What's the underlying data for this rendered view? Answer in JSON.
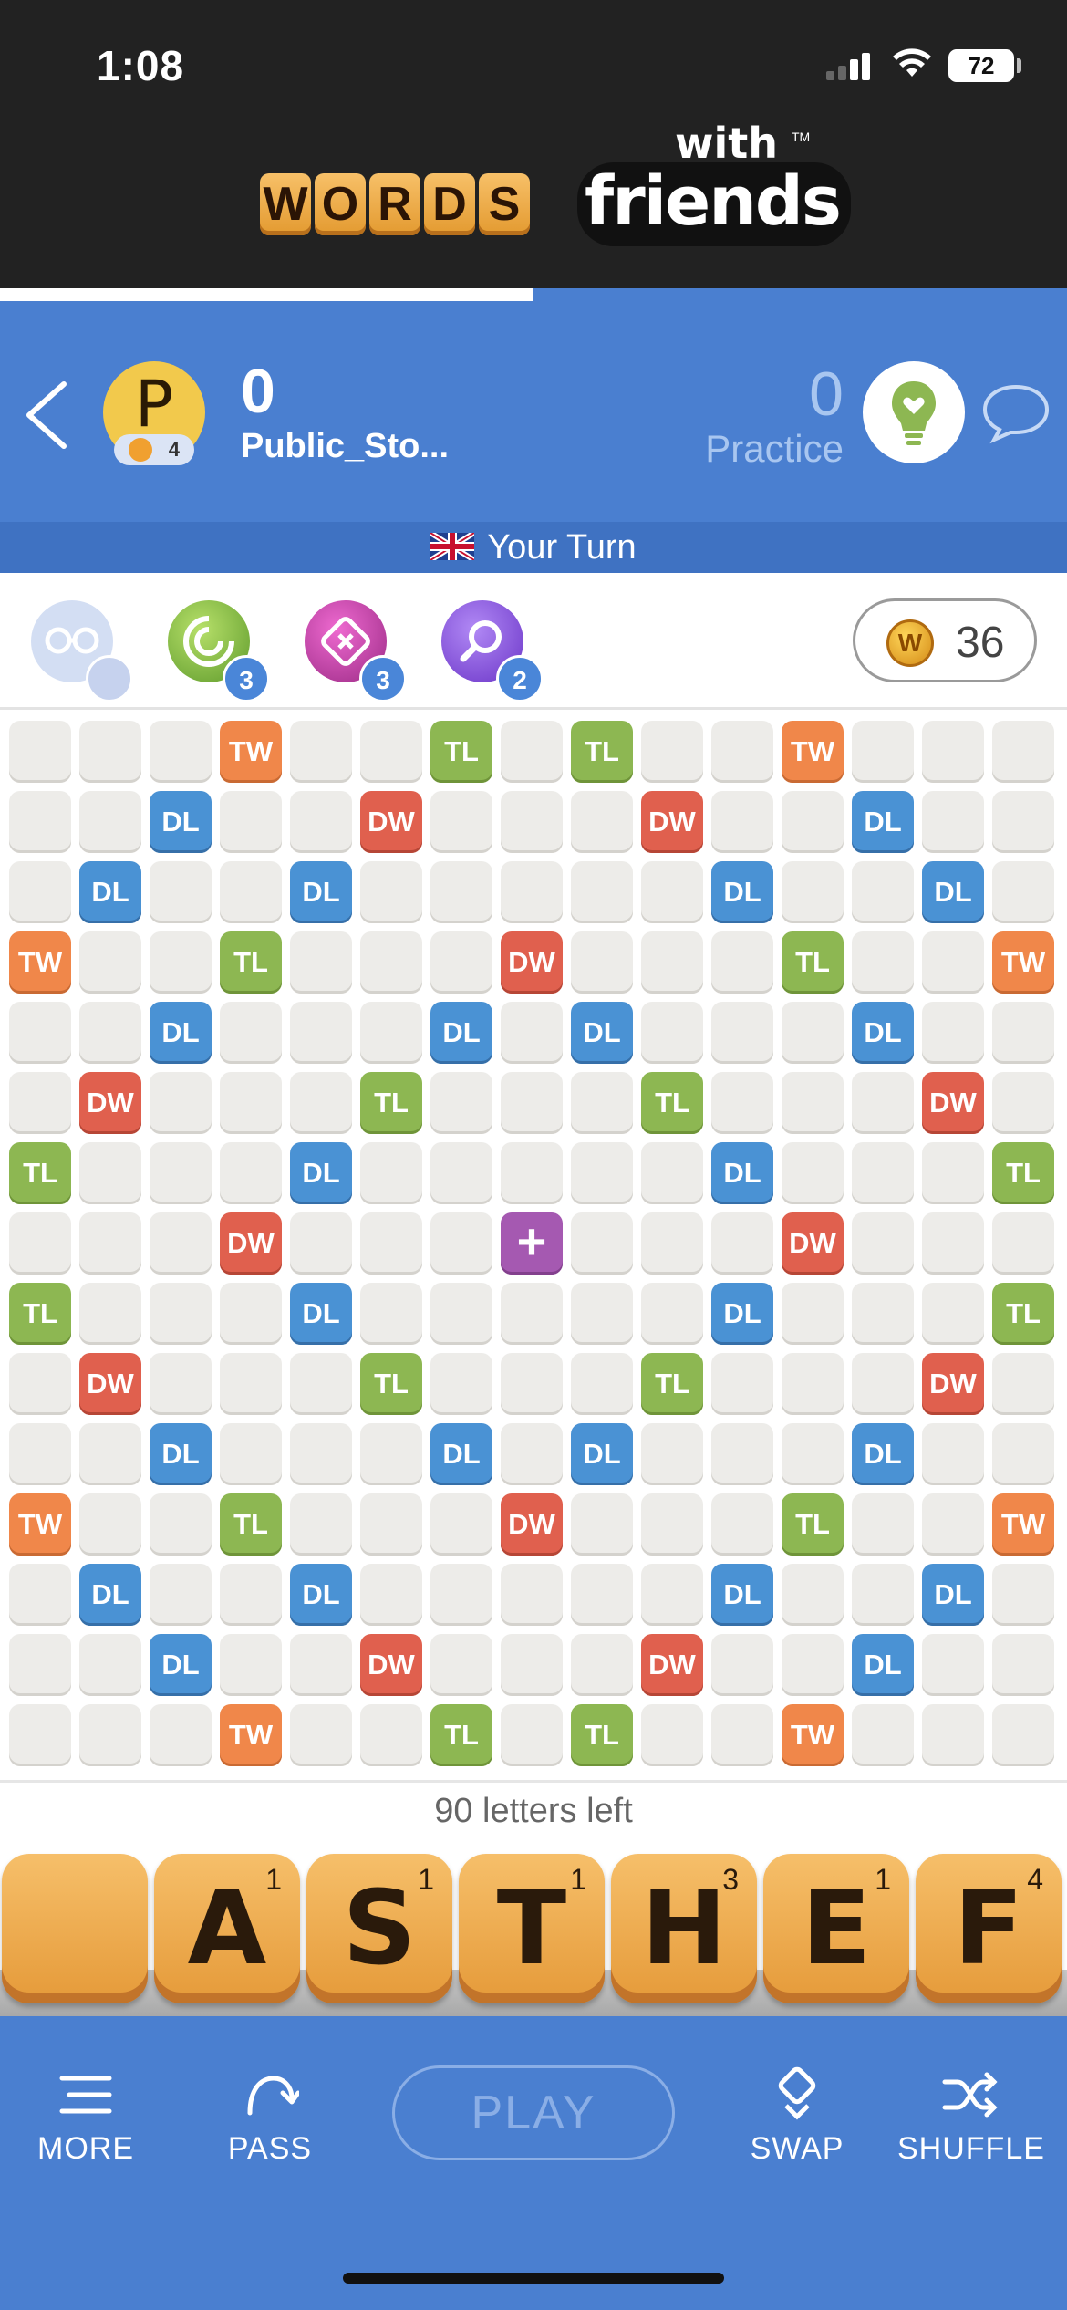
{
  "status": {
    "time": "1:08",
    "battery": "72"
  },
  "logo": {
    "tiles": [
      "W",
      "O",
      "R",
      "D",
      "S"
    ],
    "with": "with",
    "friends": "friends",
    "tm": "TM"
  },
  "game_progress": 0.5,
  "player": {
    "avatar_letter": "P",
    "level": "4",
    "score": "0",
    "name": "Public_Sto..."
  },
  "opponent": {
    "score": "0",
    "label": "Practice"
  },
  "turn": {
    "text": "Your Turn"
  },
  "powerups": [
    {
      "name": "swap-powerup",
      "count": "",
      "color": "#b9c8ea"
    },
    {
      "name": "hindsight-powerup",
      "count": "3",
      "color": "#7fc04a"
    },
    {
      "name": "word-radar-powerup",
      "count": "3",
      "color": "#c843a8"
    },
    {
      "name": "word-finder-powerup",
      "count": "2",
      "color": "#8a5be0"
    }
  ],
  "coins": "36",
  "board": {
    "rows": [
      "...TW..TL.TL..TW...",
      "..DL..DW...DW..DL..",
      ".DL..DL.....DL..DL.",
      "TW..TL...DW...TL..TW",
      "..DL...DL.DL...DL..",
      ".DW...TL...TL...DW.",
      "TL...DL.....DL...TL",
      "...DW...+...DW...",
      "TL...DL.....DL...TL",
      ".DW...TL...TL...DW.",
      "..DL...DL.DL...DL..",
      "TW..TL...DW...TL..TW",
      ".DL..DL.....DL..DL.",
      "..DL..DW...DW..DL..",
      "...TW..TL.TL..TW..."
    ],
    "grid": [
      [
        "",
        "",
        "",
        "TW",
        "",
        "",
        "TL",
        "",
        "TL",
        "",
        "",
        "TW",
        "",
        "",
        ""
      ],
      [
        "",
        "",
        "DL",
        "",
        "",
        "DW",
        "",
        "",
        "",
        "DW",
        "",
        "",
        "DL",
        "",
        ""
      ],
      [
        "",
        "DL",
        "",
        "",
        "DL",
        "",
        "",
        "",
        "",
        "",
        "DL",
        "",
        "",
        "DL",
        ""
      ],
      [
        "TW",
        "",
        "",
        "TL",
        "",
        "",
        "",
        "DW",
        "",
        "",
        "",
        "TL",
        "",
        "",
        "TW"
      ],
      [
        "",
        "",
        "DL",
        "",
        "",
        "",
        "DL",
        "",
        "DL",
        "",
        "",
        "",
        "DL",
        "",
        ""
      ],
      [
        "",
        "DW",
        "",
        "",
        "",
        "TL",
        "",
        "",
        "",
        "TL",
        "",
        "",
        "",
        "DW",
        ""
      ],
      [
        "TL",
        "",
        "",
        "",
        "DL",
        "",
        "",
        "",
        "",
        "",
        "DL",
        "",
        "",
        "",
        "TL"
      ],
      [
        "",
        "",
        "",
        "DW",
        "",
        "",
        "",
        "+",
        "",
        "",
        "",
        "DW",
        "",
        "",
        ""
      ],
      [
        "TL",
        "",
        "",
        "",
        "DL",
        "",
        "",
        "",
        "",
        "",
        "DL",
        "",
        "",
        "",
        "TL"
      ],
      [
        "",
        "DW",
        "",
        "",
        "",
        "TL",
        "",
        "",
        "",
        "TL",
        "",
        "",
        "",
        "DW",
        ""
      ],
      [
        "",
        "",
        "DL",
        "",
        "",
        "",
        "DL",
        "",
        "DL",
        "",
        "",
        "",
        "DL",
        "",
        ""
      ],
      [
        "TW",
        "",
        "",
        "TL",
        "",
        "",
        "",
        "DW",
        "",
        "",
        "",
        "TL",
        "",
        "",
        "TW"
      ],
      [
        "",
        "DL",
        "",
        "",
        "DL",
        "",
        "",
        "",
        "",
        "",
        "DL",
        "",
        "",
        "DL",
        ""
      ],
      [
        "",
        "",
        "DL",
        "",
        "",
        "DW",
        "",
        "",
        "",
        "DW",
        "",
        "",
        "DL",
        "",
        ""
      ],
      [
        "",
        "",
        "",
        "TW",
        "",
        "",
        "TL",
        "",
        "TL",
        "",
        "",
        "TW",
        "",
        "",
        ""
      ]
    ]
  },
  "letters_left": "90 letters left",
  "rack": [
    {
      "letter": "",
      "value": ""
    },
    {
      "letter": "A",
      "value": "1"
    },
    {
      "letter": "S",
      "value": "1"
    },
    {
      "letter": "T",
      "value": "1"
    },
    {
      "letter": "H",
      "value": "3"
    },
    {
      "letter": "E",
      "value": "1"
    },
    {
      "letter": "F",
      "value": "4"
    }
  ],
  "actions": {
    "more": "MORE",
    "pass": "PASS",
    "play": "PLAY",
    "swap": "SWAP",
    "shuffle": "SHUFFLE"
  },
  "colors": {
    "header_blue": "#4a7fd0",
    "turn_bar": "#3f72c2",
    "tw": "#f0874a",
    "tl": "#8db752",
    "dl": "#4a92d4",
    "dw": "#e0604e",
    "center": "#a559b1",
    "tile": "#f6bf6a"
  }
}
